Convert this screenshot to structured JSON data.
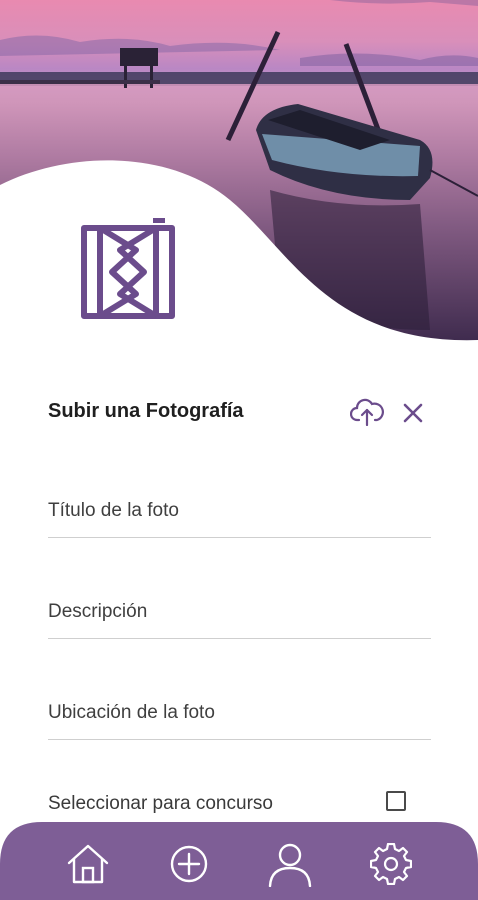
{
  "header": {
    "background": "lake-sunset-boat-photo"
  },
  "brand": {
    "logo_icon": "app-logo-icon",
    "color": "#6b4c8c"
  },
  "form": {
    "title": "Subir una Fotografía",
    "upload_icon": "cloud-upload-icon",
    "close_icon": "close-icon",
    "fields": {
      "title_placeholder": "Título de la foto",
      "description_placeholder": "Descripción",
      "location_placeholder": "Ubicación de la foto"
    },
    "contest_label": "Seleccionar para concurso",
    "contest_checked": false
  },
  "bottom_nav": {
    "background_color": "#7e5e96",
    "items": [
      {
        "icon": "home-icon"
      },
      {
        "icon": "add-circle-icon"
      },
      {
        "icon": "profile-icon"
      },
      {
        "icon": "settings-gear-icon"
      }
    ]
  }
}
